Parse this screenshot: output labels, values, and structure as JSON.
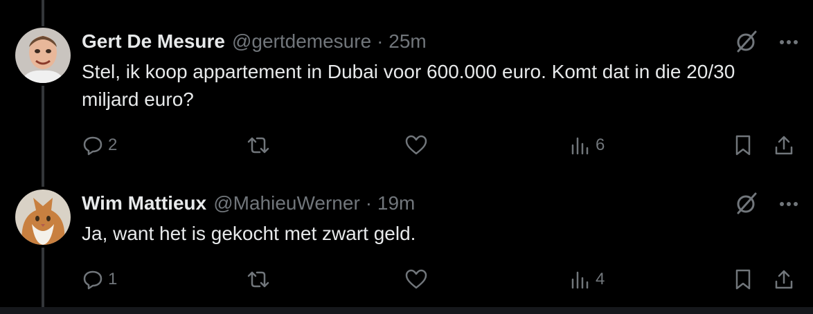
{
  "tweets": [
    {
      "name": "Gert De Mesure",
      "handle": "@gertdemesure",
      "time": "· 25m",
      "text": "Stel, ik koop appartement in Dubai voor 600.000 euro. Komt dat in die 20/30 miljard euro?",
      "replies": "2",
      "retweets": "",
      "likes": "",
      "views": "6"
    },
    {
      "name": "Wim Mattieux",
      "handle": "@MahieuWerner",
      "time": "· 19m",
      "text": "Ja, want het is gekocht met zwart geld.",
      "replies": "1",
      "retweets": "",
      "likes": "",
      "views": "4"
    }
  ],
  "icons": {
    "reply": "reply-icon",
    "retweet": "retweet-icon",
    "like": "heart-icon",
    "views": "views-icon",
    "bookmark": "bookmark-icon",
    "share": "share-icon",
    "grok": "grok-icon",
    "more": "more-icon"
  },
  "colors": {
    "background": "#000000",
    "text": "#e7e9ea",
    "muted": "#71767b",
    "thread_line": "#333639"
  }
}
